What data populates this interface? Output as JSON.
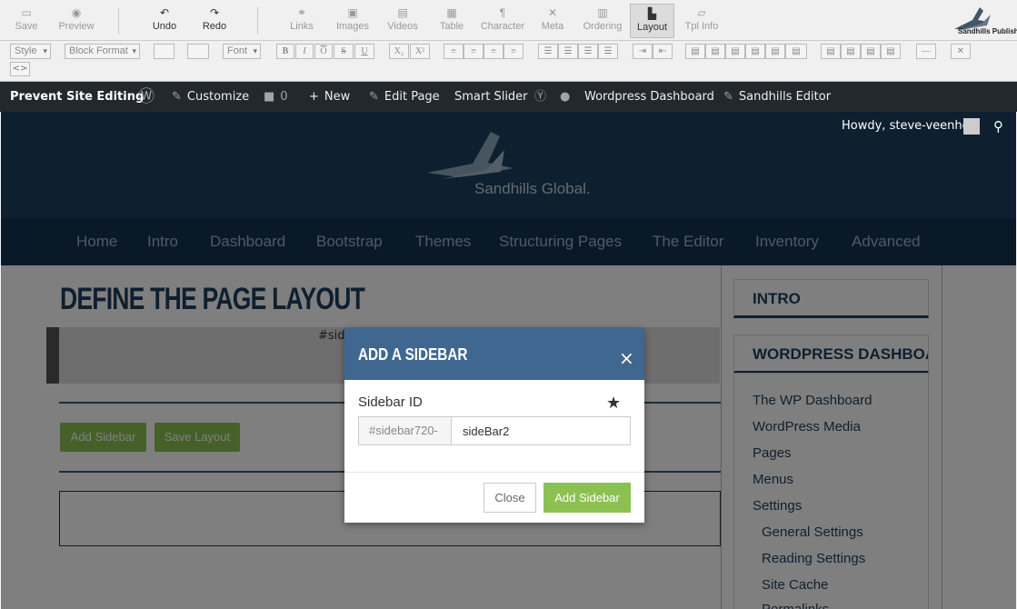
{
  "toolbar1": {
    "buttons": [
      {
        "label": "Save",
        "icon": "save-icon"
      },
      {
        "label": "Preview",
        "icon": "preview-icon"
      },
      {
        "label": "Undo",
        "icon": "undo-icon"
      },
      {
        "label": "Redo",
        "icon": "redo-icon"
      },
      {
        "label": "Links",
        "icon": "link-icon"
      },
      {
        "label": "Images",
        "icon": "image-icon"
      },
      {
        "label": "Videos",
        "icon": "video-icon"
      },
      {
        "label": "Table",
        "icon": "table-icon"
      },
      {
        "label": "Character",
        "icon": "pilcrow-icon"
      },
      {
        "label": "Meta",
        "icon": "tools-icon"
      },
      {
        "label": "Ordering",
        "icon": "ordering-icon"
      },
      {
        "label": "Layout",
        "icon": "layout-icon"
      },
      {
        "label": "Tpl Info",
        "icon": "folder-icon"
      }
    ],
    "logo_text": "Sandhills Publishing"
  },
  "toolbar2": {
    "style_select": "Style",
    "block_format_select": "Block Format",
    "font_select": "Font",
    "bold": "B",
    "italic": "I",
    "overline": "O",
    "strike": "S",
    "underline": "U",
    "subscript": "X₂",
    "superscript": "X²"
  },
  "adminbar": {
    "prevent": "Prevent Site Editing",
    "customize": "Customize",
    "comments_count": "0",
    "new": "New",
    "edit_page": "Edit Page",
    "smart_slider": "Smart Slider",
    "wp_dashboard": "Wordpress Dashboard",
    "sandhills_editor": "Sandhills Editor"
  },
  "site": {
    "howdy": "Howdy, steve-veenhof",
    "logo_text": "Sandhills Global.",
    "nav": [
      "Home",
      "Intro",
      "Dashboard",
      "Bootstrap",
      "Themes",
      "Structuring Pages",
      "The Editor",
      "Inventory",
      "Advanced"
    ]
  },
  "main": {
    "title": "DEFINE THE PAGE LAYOUT",
    "sidebar_ref": "#sid",
    "add_sidebar_btn": "Add Sidebar",
    "save_layout_btn": "Save Layout"
  },
  "sidebar": {
    "heading1": "INTRO",
    "heading2": "WORDPRESS DASHBOA...",
    "links": [
      "The WP Dashboard",
      "WordPress Media",
      "Pages",
      "Menus",
      "Settings",
      "General Settings",
      "Reading Settings",
      "Site Cache",
      "Permalinks"
    ]
  },
  "modal": {
    "title": "ADD A SIDEBAR",
    "close_glyph": "×",
    "label": "Sidebar ID",
    "prefix": "#sidebar720-",
    "input_value": "sideBar2",
    "close_btn": "Close",
    "add_btn": "Add Sidebar"
  },
  "colors": {
    "header_blue": "#1d3f5f",
    "modal_header": "#40678f",
    "accent_green": "#8cc152",
    "admin_bar": "#23282d"
  }
}
